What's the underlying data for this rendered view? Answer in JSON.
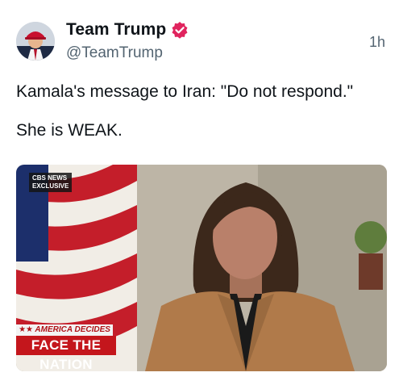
{
  "author": {
    "display_name": "Team Trump",
    "handle": "@TeamTrump",
    "verified_icon": "verified-badge-icon"
  },
  "timestamp": "1h",
  "body": {
    "line1": "Kamala's message to Iran: \"Do not respond.\"",
    "line2": "She is WEAK."
  },
  "media": {
    "network_badge": {
      "line1": "CBS NEWS",
      "line2": "EXCLUSIVE"
    },
    "lower_third": {
      "top": "★★ AMERICA DECIDES ★★",
      "bottom": "FACE THE NATION"
    }
  },
  "colors": {
    "verified": "#e0245e",
    "cbs_red": "#c4161c"
  }
}
